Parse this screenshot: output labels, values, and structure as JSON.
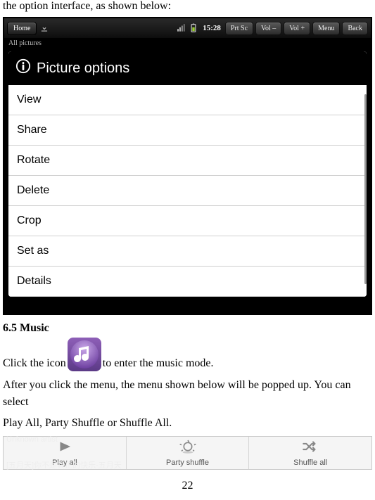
{
  "doc": {
    "intro": "the option interface, as shown below:",
    "section_title": "6.5 Music",
    "music_before": "Click the icon",
    "music_after": " to enter the music mode.",
    "para1": "After you click the menu, the menu shown below will be popped up. You can select",
    "para2": "Play All, Party Shuffle or Shuffle All.",
    "page_num": "22"
  },
  "statusbar": {
    "home": "Home",
    "time": "15:28",
    "buttons": {
      "prtsc": "Prt Sc",
      "voldown": "Vol –",
      "volup": "Vol +",
      "menu": "Menu",
      "back": "Back"
    }
  },
  "subheader": "All pictures",
  "dialog": {
    "title": "Picture options",
    "items": [
      "View",
      "Share",
      "Rotate",
      "Delete",
      "Crop",
      "Set as",
      "Details"
    ]
  },
  "menu": {
    "playall": "Play all",
    "party": "Party shuffle",
    "shuffle": "Shuffle all",
    "ghost_top": "Unknown artist",
    "ghost_bottom": "[五月天]你不是真正的快乐-五月天"
  }
}
